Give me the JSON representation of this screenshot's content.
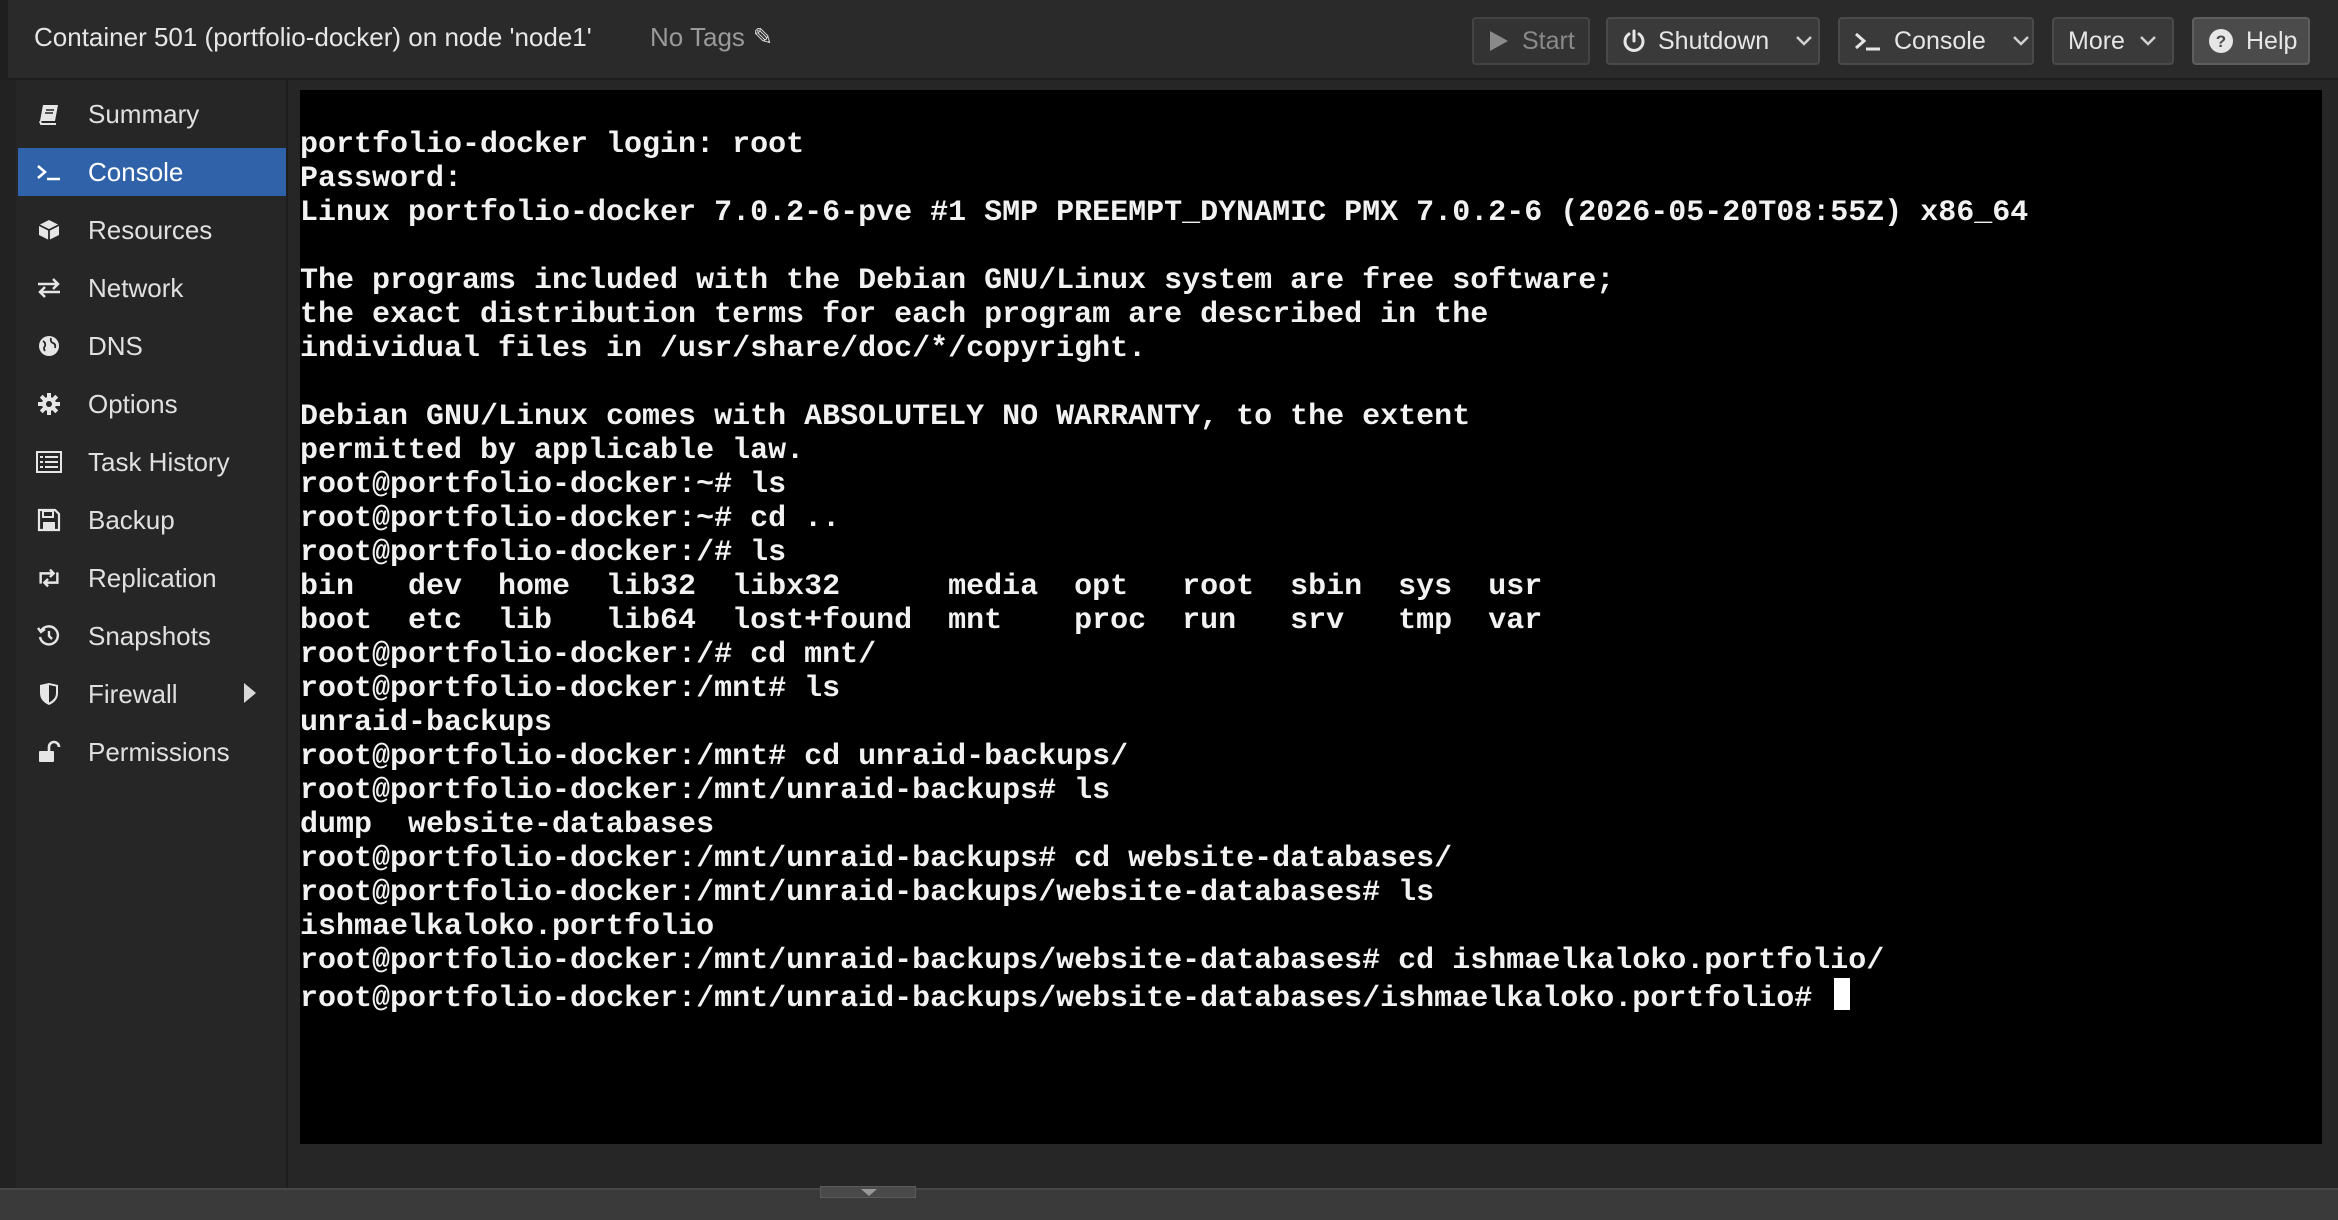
{
  "header": {
    "title": "Container 501 (portfolio-docker) on node 'node1'",
    "tags_label": "No Tags"
  },
  "toolbar": {
    "start_label": "Start",
    "shutdown_label": "Shutdown",
    "console_label": "Console",
    "more_label": "More",
    "help_label": "Help"
  },
  "sidebar": {
    "items": [
      {
        "label": "Summary",
        "icon": "book-icon"
      },
      {
        "label": "Console",
        "icon": "terminal-icon",
        "active": true
      },
      {
        "label": "Resources",
        "icon": "cube-icon"
      },
      {
        "label": "Network",
        "icon": "exchange-icon"
      },
      {
        "label": "DNS",
        "icon": "globe-icon"
      },
      {
        "label": "Options",
        "icon": "gear-icon"
      },
      {
        "label": "Task History",
        "icon": "list-icon"
      },
      {
        "label": "Backup",
        "icon": "floppy-icon"
      },
      {
        "label": "Replication",
        "icon": "retweet-icon"
      },
      {
        "label": "Snapshots",
        "icon": "history-icon"
      },
      {
        "label": "Firewall",
        "icon": "shield-icon"
      },
      {
        "label": "Permissions",
        "icon": "unlock-icon"
      }
    ]
  },
  "terminal": {
    "lines": [
      "portfolio-docker login: root",
      "Password:",
      "Linux portfolio-docker 7.0.2-6-pve #1 SMP PREEMPT_DYNAMIC PMX 7.0.2-6 (2026-05-20T08:55Z) x86_64",
      "",
      "The programs included with the Debian GNU/Linux system are free software;",
      "the exact distribution terms for each program are described in the",
      "individual files in /usr/share/doc/*/copyright.",
      "",
      "Debian GNU/Linux comes with ABSOLUTELY NO WARRANTY, to the extent",
      "permitted by applicable law.",
      "root@portfolio-docker:~# ls",
      "root@portfolio-docker:~# cd ..",
      "root@portfolio-docker:/# ls",
      "bin   dev  home  lib32  libx32      media  opt   root  sbin  sys  usr",
      "boot  etc  lib   lib64  lost+found  mnt    proc  run   srv   tmp  var",
      "root@portfolio-docker:/# cd mnt/",
      "root@portfolio-docker:/mnt# ls",
      "unraid-backups",
      "root@portfolio-docker:/mnt# cd unraid-backups/",
      "root@portfolio-docker:/mnt/unraid-backups# ls",
      "dump  website-databases",
      "root@portfolio-docker:/mnt/unraid-backups# cd website-databases/",
      "root@portfolio-docker:/mnt/unraid-backups/website-databases# ls",
      "ishmaelkaloko.portfolio",
      "root@portfolio-docker:/mnt/unraid-backups/website-databases# cd ishmaelkaloko.portfolio/",
      "root@portfolio-docker:/mnt/unraid-backups/website-databases/ishmaelkaloko.portfolio# "
    ]
  }
}
